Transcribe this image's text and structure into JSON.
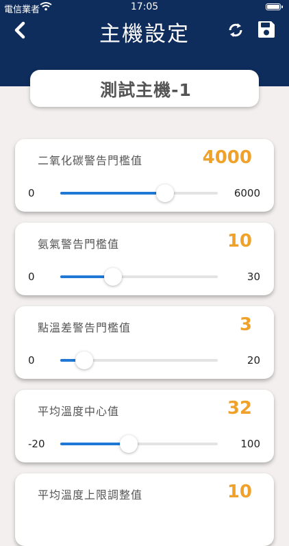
{
  "status_bar": {
    "carrier": "電信業者",
    "time": "17:05"
  },
  "nav": {
    "title": "主機設定",
    "back_icon": "chevron-left-icon",
    "sync_icon": "sync-icon",
    "save_icon": "floppy-save-icon"
  },
  "host": {
    "name": "測試主機-1"
  },
  "colors": {
    "header_bg": "#0f2d5c",
    "accent": "#f0a12a",
    "slider_fill": "#1f78d6",
    "page_bg": "#f2efee"
  },
  "settings": [
    {
      "label": "二氧化碳警告門檻值",
      "value": "4000",
      "min": "0",
      "max": "6000",
      "level": 0.6667
    },
    {
      "label": "氨氣警告門檻值",
      "value": "10",
      "min": "0",
      "max": "30",
      "level": 0.3333
    },
    {
      "label": "點溫差警告門檻值",
      "value": "3",
      "min": "0",
      "max": "20",
      "level": 0.15
    },
    {
      "label": "平均溫度中心值",
      "value": "32",
      "min": "-20",
      "max": "100",
      "level": 0.4333
    },
    {
      "label": "平均溫度上限調整值",
      "value": "10",
      "min": "",
      "max": "",
      "level": 0.0
    }
  ]
}
